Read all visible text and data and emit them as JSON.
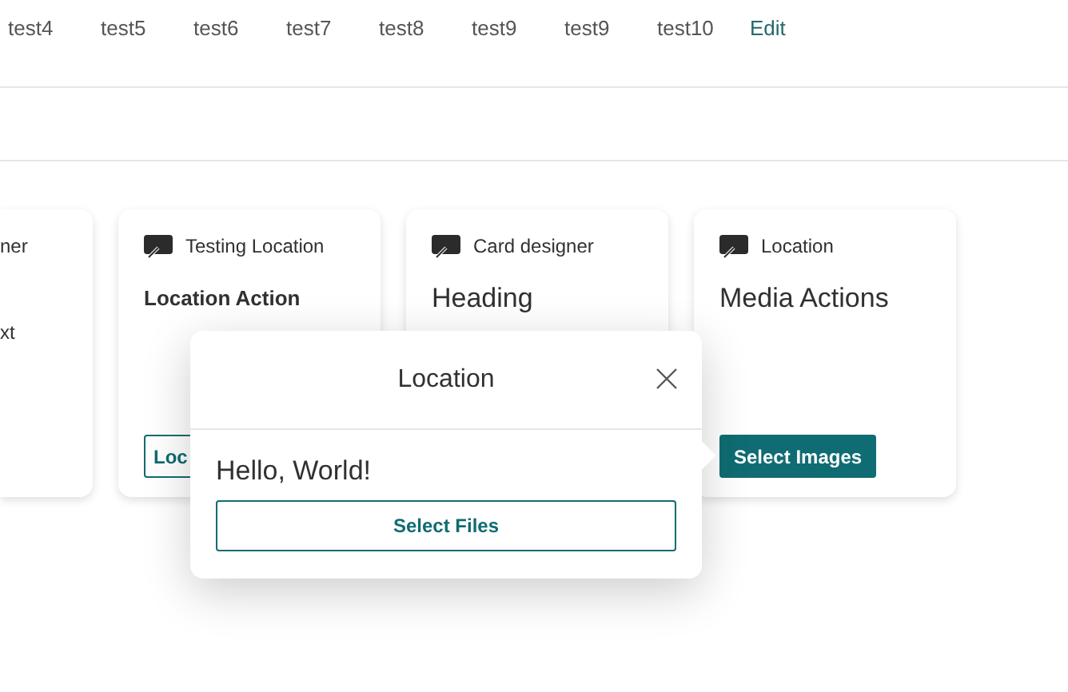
{
  "nav": {
    "items": [
      {
        "label": "test4"
      },
      {
        "label": "test5"
      },
      {
        "label": "test6"
      },
      {
        "label": "test7"
      },
      {
        "label": "test8"
      },
      {
        "label": "test9"
      },
      {
        "label": "test9"
      },
      {
        "label": "test10"
      }
    ],
    "edit": "Edit"
  },
  "cards": [
    {
      "kind": "partial",
      "source": "ner",
      "body": "xt"
    },
    {
      "kind": "compact",
      "source": "Testing Location",
      "heading": "Location Action",
      "button": {
        "label": "Loc",
        "kind": "outline"
      }
    },
    {
      "kind": "standard",
      "source": "Card designer",
      "heading": "Heading"
    },
    {
      "kind": "standard",
      "source": "Location",
      "heading": "Media Actions",
      "button": {
        "label": "Select Images",
        "kind": "filled"
      }
    }
  ],
  "popover": {
    "title": "Location",
    "heading": "Hello, World!",
    "button": "Select Files"
  }
}
